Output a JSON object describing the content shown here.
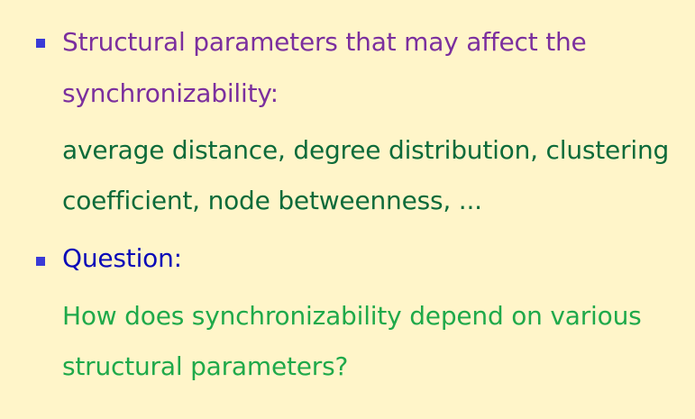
{
  "colors": {
    "background": "#fff5c9",
    "bullet": "#3a3ad6",
    "heading1": "#7b2f9e",
    "body1": "#0d6b3a",
    "heading2": "#0a0ab8",
    "body2": "#1fa94a"
  },
  "bullets": [
    {
      "heading_lines": [
        "Structural parameters that may affect the",
        "synchronizability:"
      ],
      "body_lines": [
        "average distance, degree distribution, clustering",
        "coefficient, node betweenness, ..."
      ]
    },
    {
      "heading_lines": [
        "Question:"
      ],
      "body_lines": [
        "How does synchronizability depend on various",
        "structural parameters?"
      ]
    }
  ]
}
